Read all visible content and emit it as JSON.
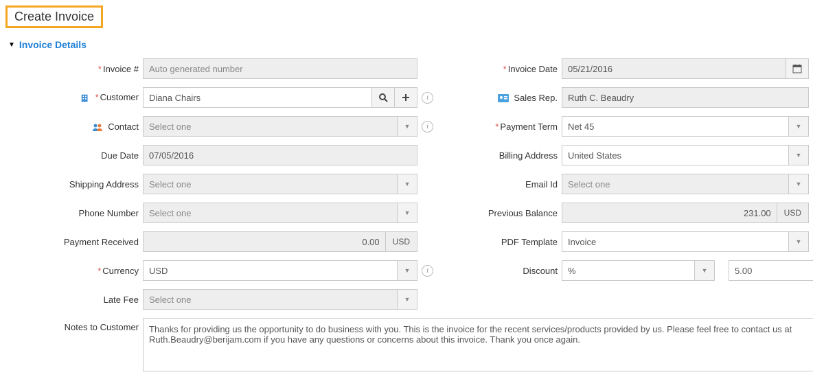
{
  "page_title": "Create Invoice",
  "section_title": "Invoice Details",
  "labels": {
    "invoice_no": "Invoice #",
    "invoice_date": "Invoice Date",
    "customer": "Customer",
    "sales_rep": "Sales Rep.",
    "contact": "Contact",
    "payment_term": "Payment Term",
    "due_date": "Due Date",
    "billing_address": "Billing Address",
    "shipping_address": "Shipping Address",
    "email_id": "Email Id",
    "phone_number": "Phone Number",
    "previous_balance": "Previous Balance",
    "payment_received": "Payment Received",
    "pdf_template": "PDF Template",
    "currency": "Currency",
    "discount": "Discount",
    "late_fee": "Late Fee",
    "notes_to_customer": "Notes to Customer"
  },
  "placeholders": {
    "select_one": "Select one",
    "auto_gen": "Auto generated number"
  },
  "values": {
    "invoice_date": "05/21/2016",
    "customer": "Diana Chairs",
    "sales_rep": "Ruth C. Beaudry",
    "payment_term": "Net 45",
    "due_date": "07/05/2016",
    "billing_address": "United States",
    "previous_balance": "231.00",
    "payment_received": "0.00",
    "pdf_template": "Invoice",
    "currency": "USD",
    "discount_type": "%",
    "discount_value": "5.00",
    "notes": "Thanks for providing us the opportunity to do business with you. This is the invoice for the recent services/products provided by us. Please feel free to contact us at Ruth.Beaudry@berijam.com if you have any questions or concerns about this invoice. Thank you once again."
  },
  "addons": {
    "usd": "USD"
  }
}
